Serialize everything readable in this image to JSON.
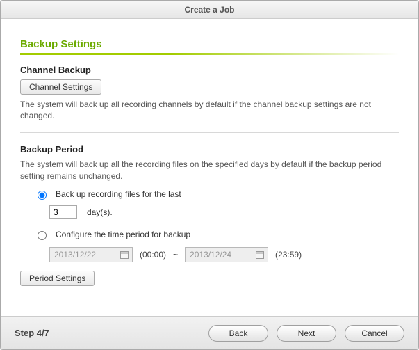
{
  "window": {
    "title": "Create a Job"
  },
  "page": {
    "title": "Backup Settings"
  },
  "channel": {
    "heading": "Channel Backup",
    "settings_btn": "Channel Settings",
    "description": "The system will back up all recording channels by default if the channel backup settings are not changed."
  },
  "period": {
    "heading": "Backup Period",
    "description": "The system will back up all the recording files on the specified days by default if the backup period setting remains unchanged.",
    "option_last": "Back up recording files for the last",
    "days_value": "3",
    "days_suffix": "day(s).",
    "option_range": "Configure the time period for backup",
    "from_date": "2013/12/22",
    "from_time": "(00:00)",
    "tilde": "~",
    "to_date": "2013/12/24",
    "to_time": "(23:59)",
    "settings_btn": "Period Settings"
  },
  "footer": {
    "step": "Step 4/7",
    "back": "Back",
    "next": "Next",
    "cancel": "Cancel"
  }
}
